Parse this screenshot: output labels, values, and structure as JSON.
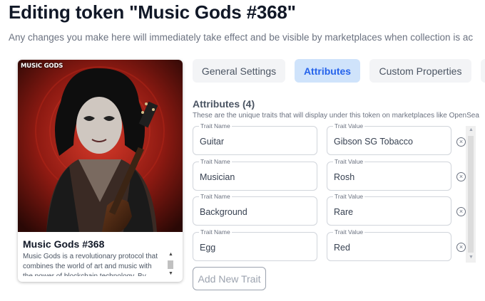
{
  "page": {
    "title": "Editing token \"Music Gods #368\"",
    "subtitle": "Any changes you make here will immediately take effect and be visible by marketplaces when collection is ac"
  },
  "token": {
    "brand_logo": "MUSIC GODS",
    "name": "Music Gods #368",
    "description": "Music Gods is a revolutionary protocol that combines the world of art and music with the power of blockchain technology. By"
  },
  "tabs": [
    {
      "label": "General Settings",
      "active": false
    },
    {
      "label": "Attributes",
      "active": true
    },
    {
      "label": "Custom Properties",
      "active": false
    }
  ],
  "attributes": {
    "heading": "Attributes (4)",
    "description": "These are the unique traits that will display under this token on marketplaces like OpenSea",
    "name_label": "Trait Name",
    "value_label": "Trait Value",
    "rows": [
      {
        "name": "Guitar",
        "value": "Gibson SG Tobacco"
      },
      {
        "name": "Musician",
        "value": "Rosh"
      },
      {
        "name": "Background",
        "value": "Rare"
      },
      {
        "name": "Egg",
        "value": "Red"
      }
    ],
    "add_button": "Add New Trait"
  },
  "icons": {
    "remove": "remove-circle-icon",
    "scroll_up": "scroll-up-arrow-icon",
    "scroll_down": "scroll-down-arrow-icon"
  },
  "colors": {
    "accent": "#2563eb",
    "active_tab_bg": "#cfe3fb"
  }
}
